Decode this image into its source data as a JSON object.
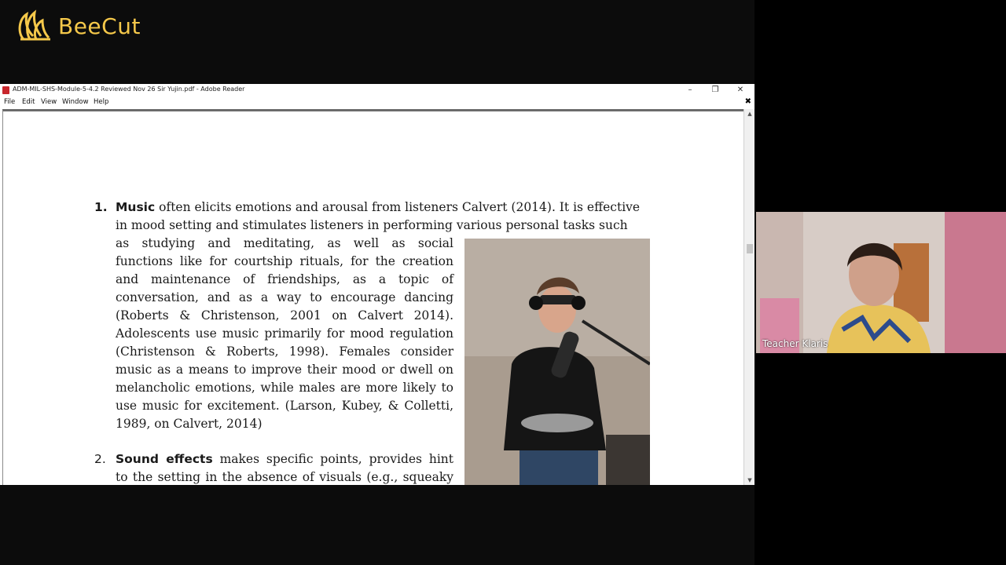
{
  "branding": {
    "name": "BeeCut"
  },
  "window": {
    "title": "ADM-MIL-SHS-Module-5-4.2 Reviewed Nov 26 Sir Yujin.pdf - Adobe Reader",
    "controls": {
      "minimize": "–",
      "restore": "❐",
      "close": "✕"
    }
  },
  "menu": {
    "items": [
      "File",
      "Edit",
      "View",
      "Window",
      "Help"
    ],
    "doc_close": "✖"
  },
  "document": {
    "item1": {
      "number": "1.",
      "term": "Music",
      "lines": [
        "often elicits emotions and arousal from listeners Calvert (2014). It is effective",
        "in mood setting and stimulates listeners in performing various personal tasks such",
        "as studying and meditating, as well as social",
        "functions like for courtship rituals, for the creation",
        "and maintenance of friendships, as a topic of",
        "conversation, and as a way to encourage dancing",
        "(Roberts & Christenson, 2001 on Calvert 2014).",
        "Adolescents use music primarily for mood regulation",
        "(Christenson & Roberts, 1998). Females consider",
        "music as a means to improve their mood or dwell on",
        "melancholic emotions, while males are more likely to",
        "use music for excitement. (Larson, Kubey, & Colletti,",
        "1989, on Calvert, 2014)"
      ]
    },
    "item2": {
      "number": "2.",
      "term": "Sound effects",
      "lines": [
        "makes specific points, provides hint",
        "to the setting in the absence of visuals (e.g., squeaky"
      ]
    }
  },
  "video": {
    "participant_name": "Teacher Klaris"
  }
}
